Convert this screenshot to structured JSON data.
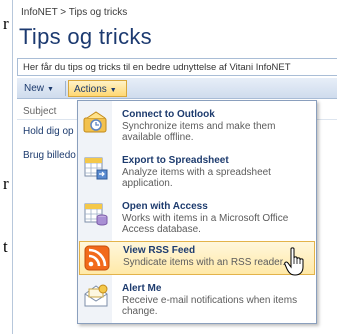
{
  "page_fragments": {
    "left_chars": [
      "r",
      "r",
      "t"
    ]
  },
  "sharepoint": {
    "breadcrumb": "InfoNET > Tips og tricks",
    "title": "Tips og tricks",
    "description": "Her får du tips og tricks til en bedre udnyttelse af Vitani InfoNET",
    "toolbar": {
      "new_label": "New",
      "actions_label": "Actions"
    },
    "list": {
      "column_subject": "Subject",
      "items": [
        "Hold dig op",
        "Brug billedo"
      ]
    }
  },
  "actions_menu": {
    "items": [
      {
        "icon": "outlook-connect-icon",
        "title": "Connect to Outlook",
        "desc": "Synchronize items and make them available offline."
      },
      {
        "icon": "spreadsheet-export-icon",
        "title": "Export to Spreadsheet",
        "desc": "Analyze items with a spreadsheet application."
      },
      {
        "icon": "access-database-icon",
        "title": "Open with Access",
        "desc": "Works with items in a Microsoft Office Access database."
      },
      {
        "icon": "rss-feed-icon",
        "title": "View RSS Feed",
        "desc": "Syndicate items with an RSS reader."
      },
      {
        "icon": "alert-me-icon",
        "title": "Alert Me",
        "desc": "Receive e-mail notifications when items change."
      }
    ],
    "hovered_index": 3
  },
  "colors": {
    "title": "#1c3a70",
    "hover_bg": "#ffe9a8",
    "rss_orange": "#f26a1b"
  }
}
